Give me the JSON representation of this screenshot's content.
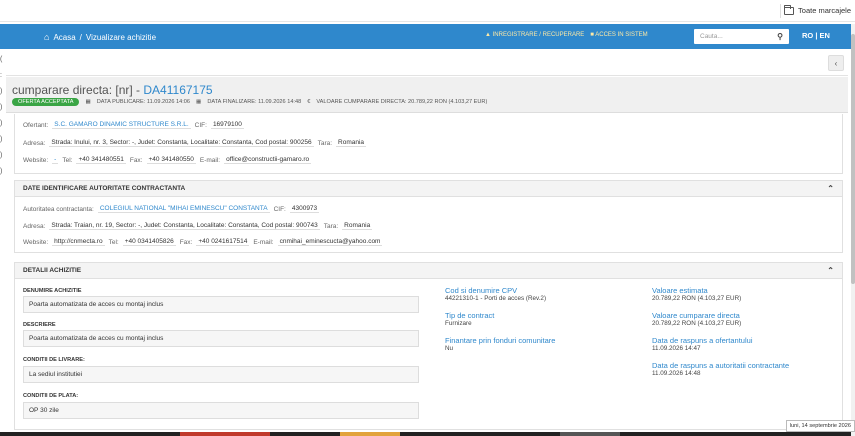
{
  "bookmarks": {
    "all_label": "Toate marcajele"
  },
  "nav": {
    "home": "Acasa",
    "separator": "/",
    "current": "Vizualizare achizitie",
    "register": "INREGISTRARE / RECUPERARE",
    "login": "ACCES IN SISTEM",
    "search_placeholder": "Cauta...",
    "lang": "RO | EN"
  },
  "header": {
    "title_prefix": "cumparare directa: [nr] - ",
    "code": "DA41167175",
    "status": "OFERTA ACCEPTATA",
    "date_pub": "DATA PUBLICARE: 11.09.2026 14:06",
    "date_fin": "DATA FINALIZARE: 11.09.2026 14:48",
    "value": "VALOARE CUMPARARE DIRECTA: 20.789,22  RON (4.103,27  EUR)"
  },
  "ofertant": {
    "label": "Ofertant:",
    "name": "S.C. GAMARO DINAMIC STRUCTURE S.R.L.",
    "cif_label": "CIF:",
    "cif": "16979100",
    "adresa_label": "Adresa:",
    "adresa": "Strada: Inului, nr. 3, Sector: -, Judet: Constanta, Localitate: Constanta, Cod postal: 900256",
    "tara_label": "Tara:",
    "tara": "Romania",
    "website_label": "Website:",
    "website": "-",
    "tel_label": "Tel:",
    "tel": "+40 341480551",
    "fax_label": "Fax:",
    "fax": "+40 341480550",
    "email_label": "E-mail:",
    "email": "office@constructii-gamaro.ro"
  },
  "autoritate": {
    "header": "DATE IDENTIFICARE AUTORITATE CONTRACTANTA",
    "label": "Autoritatea contractanta:",
    "name": "COLEGIUL NATIONAL \"MIHAI EMINESCU\" CONSTANTA",
    "cif_label": "CIF:",
    "cif": "4300973",
    "adresa_label": "Adresa:",
    "adresa": "Strada: Traian, nr. 19, Sector: -, Judet: Constanta, Localitate: Constanta, Cod postal: 900743",
    "tara_label": "Tara:",
    "tara": "Romania",
    "website_label": "Website:",
    "website": "http://cnmecta.ro",
    "tel_label": "Tel:",
    "tel": "+40 0341405826",
    "fax_label": "Fax:",
    "fax": "+40 0241617514",
    "email_label": "E-mail:",
    "email": "cnmihai_eminescucta@yahoo.com"
  },
  "detalii": {
    "header": "DETALII ACHIZITIE",
    "denumire_label": "DENUMIRE ACHIZITIE",
    "denumire": "Poarta automatizata de acces cu montaj inclus",
    "descriere_label": "DESCRIERE",
    "descriere": "Poarta automatizata de acces cu montaj inclus",
    "livrare_label": "CONDITII DE LIVRARE:",
    "livrare": "La sediul institutiei",
    "plata_label": "CONDITII DE PLATA:",
    "plata": "OP 30 zile",
    "cpv_label": "Cod si denumire CPV",
    "cpv": "44221310-1 - Porti de acces (Rev.2)",
    "tip_label": "Tip de contract",
    "tip": "Furnizare",
    "fonduri_label": "Finantare prin fonduri comunitare",
    "fonduri": "Nu",
    "val_est_label": "Valoare estimata",
    "val_est": "20.789,22  RON (4.103,27  EUR)",
    "val_cump_label": "Valoare cumparare directa",
    "val_cump": "20.789,22  RON (4.103,27  EUR)",
    "data_oferta_label": "Data de raspuns a ofertantului",
    "data_oferta": "11.09.2026 14:47",
    "data_aut_label": "Data de raspuns a autoritatii contractante",
    "data_aut": "11.09.2026 14:48"
  },
  "status_date": "luni, 14 septembrie 2026"
}
